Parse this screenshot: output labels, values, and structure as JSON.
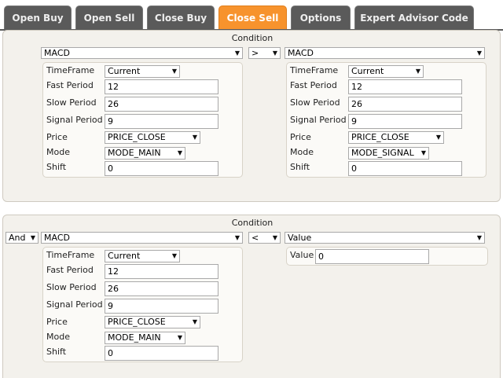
{
  "tabs": [
    {
      "label": "Open Buy"
    },
    {
      "label": "Open Sell"
    },
    {
      "label": "Close Buy"
    },
    {
      "label": "Close Sell"
    },
    {
      "label": "Options"
    },
    {
      "label": "Expert Advisor Code"
    }
  ],
  "active_tab": "Close Sell",
  "colors": {
    "active_tab": "#f7932d",
    "tab": "#5a5a5a",
    "panel": "#f3f1ec"
  },
  "condition1": {
    "title": "Condition",
    "left_indicator": "MACD",
    "operator": ">",
    "right_indicator": "MACD",
    "left": {
      "timeframe_label": "TimeFrame",
      "timeframe": "Current",
      "fast_label": "Fast Period",
      "fast": "12",
      "slow_label": "Slow Period",
      "slow": "26",
      "signal_label": "Signal Period",
      "signal": "9",
      "price_label": "Price",
      "price": "PRICE_CLOSE",
      "mode_label": "Mode",
      "mode": "MODE_MAIN",
      "shift_label": "Shift",
      "shift": "0"
    },
    "right": {
      "timeframe_label": "TimeFrame",
      "timeframe": "Current",
      "fast_label": "Fast Period",
      "fast": "12",
      "slow_label": "Slow Period",
      "slow": "26",
      "signal_label": "Signal Period",
      "signal": "9",
      "price_label": "Price",
      "price": "PRICE_CLOSE",
      "mode_label": "Mode",
      "mode": "MODE_SIGNAL",
      "shift_label": "Shift",
      "shift": "0"
    }
  },
  "condition2": {
    "title": "Condition",
    "logic": "And",
    "left_indicator": "MACD",
    "operator": "<",
    "right_indicator": "Value",
    "left": {
      "timeframe_label": "TimeFrame",
      "timeframe": "Current",
      "fast_label": "Fast Period",
      "fast": "12",
      "slow_label": "Slow Period",
      "slow": "26",
      "signal_label": "Signal Period",
      "signal": "9",
      "price_label": "Price",
      "price": "PRICE_CLOSE",
      "mode_label": "Mode",
      "mode": "MODE_MAIN",
      "shift_label": "Shift",
      "shift": "0"
    },
    "right": {
      "value_label": "Value",
      "value": "0"
    }
  },
  "icons": {
    "dropdown": "chevron-down-icon"
  }
}
